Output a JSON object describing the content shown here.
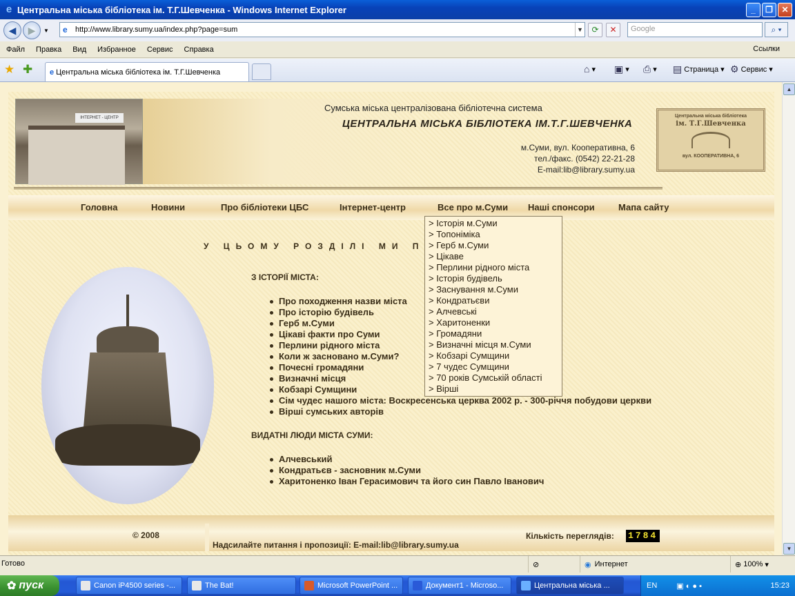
{
  "window": {
    "title": "Центральна міська бібліотека ім. Т.Г.Шевченка - Windows Internet Explorer"
  },
  "address": {
    "url": "http://www.library.sumy.ua/index.php?page=sum"
  },
  "search": {
    "placeholder": "Google"
  },
  "ie_menu": [
    "Файл",
    "Правка",
    "Вид",
    "Избранное",
    "Сервис",
    "Справка"
  ],
  "links_label": "Ссылки",
  "tab": {
    "title": "Центральна міська бібліотека ім. Т.Г.Шевченка"
  },
  "command_bar": {
    "page": "Страница",
    "tools": "Сервис"
  },
  "header": {
    "subtitle": "Сумська міська централізована бібліотечна система",
    "title": "ЦЕНТРАЛЬНА МІСЬКА БІБЛІОТЕКА ІМ.Т.Г.ШЕВЧЕНКА",
    "address": "м.Суми, вул. Кооперативна, 6",
    "phone": "тел./факс. (0542) 22-21-28",
    "email": "E-mail:lib@library.sumy.ua",
    "photo_sign": "ІНТЕРНЕТ - ЦЕНТР"
  },
  "logo": {
    "line1": "Центральна міська бібліотека",
    "line2": "ім. Т.Г.Шевченка",
    "line3": "вул. КООПЕРАТИВНА, 6"
  },
  "nav": [
    "Головна",
    "Новини",
    "Про бібліотеки ЦБС",
    "Інтернет-центр",
    "Все про м.Суми",
    "Наші спонсори",
    "Мапа сайту"
  ],
  "dropdown": [
    "> Історія м.Суми",
    "> Топоніміка",
    "> Герб м.Суми",
    "> Цікаве",
    "> Перлини рідного міста",
    "> Історія будівель",
    "> Заснування м.Суми",
    "> Кондратьєви",
    "> Алчевські",
    "> Харитоненки",
    "> Громадяни",
    "> Визначні місця м.Суми",
    "> Кобзарі Сумщини",
    "> 7 чудес Сумщини",
    "> 70 років Сумській області",
    "> Вірші"
  ],
  "intro": "У ЦЬОМУ РОЗДІЛІ МИ ПРОПОНУЄ                  Ю:",
  "history": {
    "heading": "З ІСТОРІЇ МІСТА:",
    "items": [
      "Про походження назви міста",
      "Про історію будівель",
      "Герб м.Суми",
      "Цікаві факти про Суми",
      "Перлини рідного міста",
      "Коли ж засновано м.Суми?",
      "Почесні громадяни",
      "Визначні місця",
      "Кобзарі Сумщини",
      "Сім чудес нашого міста: Воскресенська церква 2002 р. - 300-річчя побудови церкви",
      "Вірші сумських авторів"
    ]
  },
  "people": {
    "heading": "ВИДАТНІ ЛЮДИ МІСТА СУМИ:",
    "items": [
      "Алчевський",
      "Кондратьєв - засновник м.Суми",
      "Харитоненко Іван Герасимович та його син Павло Іванович"
    ]
  },
  "footer": {
    "copyright": "© 2008",
    "contact": "Надсилайте питання і пропозиції: E-mail:lib@library.sumy.ua",
    "views_label": "Кількість переглядів:",
    "views": "1784"
  },
  "status": {
    "text": "Готово",
    "zone": "Интернет",
    "zoom": "100%"
  },
  "taskbar": {
    "start": "пуск",
    "tasks": [
      "Canon iP4500 series -...",
      "The Bat!",
      "Microsoft PowerPoint ...",
      "Документ1 - Microso...",
      "Центральна міська ..."
    ],
    "lang": "EN",
    "time": "15:23"
  }
}
